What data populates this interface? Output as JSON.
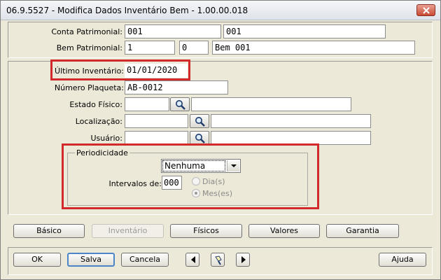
{
  "window": {
    "title": "06.9.5527 - Modifica Dados Inventário Bem - 1.00.00.018"
  },
  "header": {
    "conta_label": "Conta Patrimonial:",
    "conta_code": "001",
    "conta_desc": "001",
    "bem_label": "Bem Patrimonial:",
    "bem_code": "1",
    "bem_seq": "0",
    "bem_desc": "Bem 001"
  },
  "form": {
    "ultimo_label": "Último Inventário:",
    "ultimo_value": "01/01/2020",
    "plaqueta_label": "Número Plaqueta:",
    "plaqueta_value": "AB-0012",
    "estado_label": "Estado Físico:",
    "estado_code": "",
    "estado_desc": "",
    "local_label": "Localização:",
    "local_code": "",
    "local_desc": "",
    "usuario_label": "Usuário:",
    "usuario_code": "",
    "usuario_desc": ""
  },
  "periodicidade": {
    "title": "Periodicidade",
    "selected": "Nenhuma",
    "intervalos_label": "Intervalos de:",
    "intervalos_value": "000",
    "options": [
      "Dia(s)",
      "Mes(es)"
    ],
    "checked": "Mes(es)"
  },
  "tabs": [
    "Básico",
    "Inventário",
    "Físicos",
    "Valores",
    "Garantia"
  ],
  "active_tab": "Inventário",
  "buttons": {
    "ok": "OK",
    "salva": "Salva",
    "cancela": "Cancela",
    "ajuda": "Ajuda"
  },
  "colors": {
    "highlight": "#d12a2a",
    "window_bg": "#ece9d8",
    "default_button_border": "#4a86c8"
  }
}
